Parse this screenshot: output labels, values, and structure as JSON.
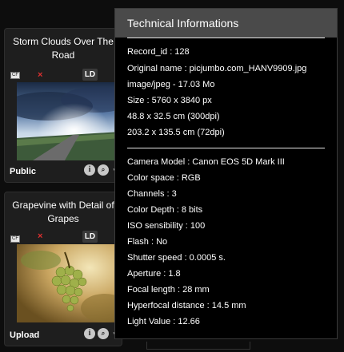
{
  "cards": [
    {
      "title_line1": "Storm Clouds Over The",
      "title_line2": "Road",
      "badge": "LD",
      "chip_label": "CF",
      "status": "Public"
    },
    {
      "title_line1": "Grapevine with Detail of",
      "title_line2": "Grapes",
      "badge": "LD",
      "chip_label": "CF",
      "status": "Upload"
    }
  ],
  "icons": {
    "info": "i",
    "zoom": "🔍"
  },
  "panel": {
    "title": "Technical Informations",
    "file_info": [
      "Record_id : 128",
      "Original name : picjumbo.com_HANV9909.jpg",
      "image/jpeg - 17.03 Mo",
      "Size : 5760 x 3840 px",
      "48.8 x 32.5 cm (300dpi)",
      "203.2 x 135.5 cm (72dpi)"
    ],
    "camera_info": [
      "Camera Model : Canon EOS 5D Mark III",
      "Color space : RGB",
      "Channels : 3",
      "Color Depth : 8 bits",
      "ISO sensibility : 100",
      "Flash : No",
      "Shutter speed : 0.0005 s.",
      "Aperture : 1.8",
      "Focal length : 28 mm",
      "Hyperfocal distance : 14.5 mm",
      "Light Value : 12.66"
    ]
  }
}
